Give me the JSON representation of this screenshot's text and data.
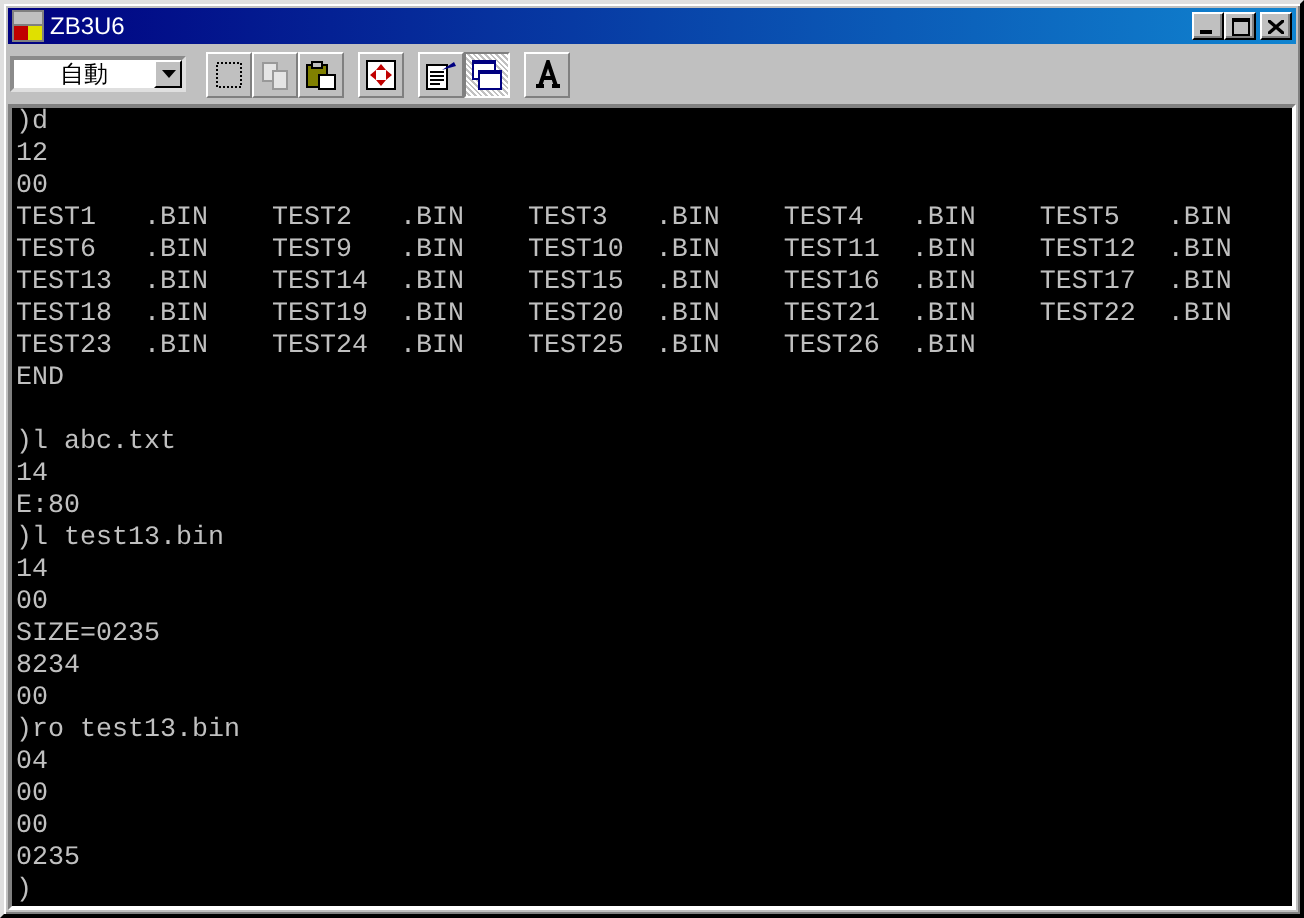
{
  "window": {
    "title": "ZB3U6"
  },
  "toolbar": {
    "font_size": {
      "value": "自動"
    },
    "buttons": [
      {
        "kind": "mark",
        "disabled": false,
        "pressed": false
      },
      {
        "kind": "copy",
        "disabled": true,
        "pressed": false
      },
      {
        "kind": "paste",
        "disabled": false,
        "pressed": false
      },
      {
        "kind": "fullscreen",
        "disabled": false,
        "pressed": false
      },
      {
        "kind": "properties",
        "disabled": false,
        "pressed": false
      },
      {
        "kind": "background",
        "disabled": false,
        "pressed": true
      },
      {
        "kind": "font",
        "disabled": false,
        "pressed": false
      }
    ]
  },
  "console": {
    "lines": [
      ")d",
      "12",
      "00",
      "TEST1   .BIN    TEST2   .BIN    TEST3   .BIN    TEST4   .BIN    TEST5   .BIN",
      "TEST6   .BIN    TEST9   .BIN    TEST10  .BIN    TEST11  .BIN    TEST12  .BIN",
      "TEST13  .BIN    TEST14  .BIN    TEST15  .BIN    TEST16  .BIN    TEST17  .BIN",
      "TEST18  .BIN    TEST19  .BIN    TEST20  .BIN    TEST21  .BIN    TEST22  .BIN",
      "TEST23  .BIN    TEST24  .BIN    TEST25  .BIN    TEST26  .BIN",
      "END"
    ],
    "block_2": [
      ")l abc.txt",
      "14",
      "E:80",
      ")l test13.bin",
      "14",
      "00",
      "SIZE=0235",
      "8234",
      "00",
      ")ro test13.bin",
      "04",
      "00",
      "00",
      "0235",
      ")"
    ]
  }
}
